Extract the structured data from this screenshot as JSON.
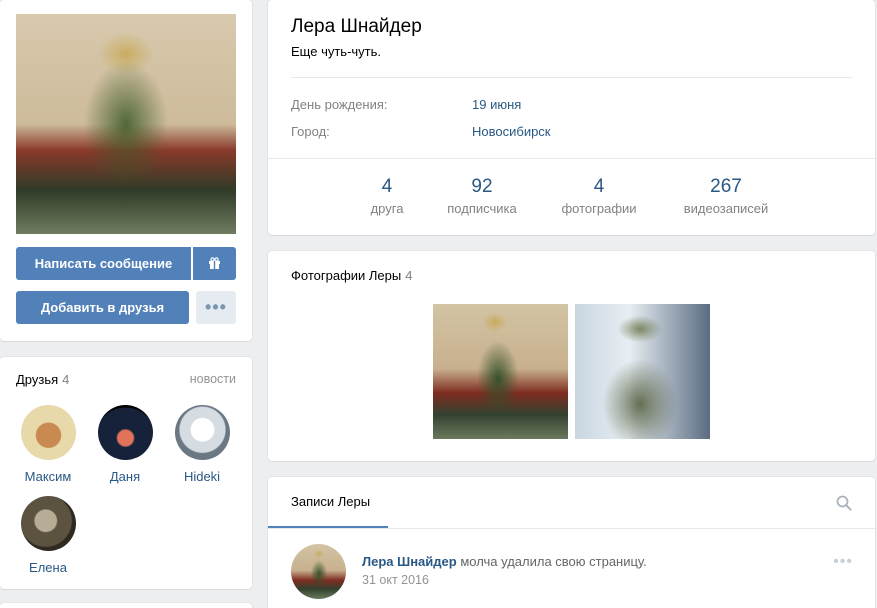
{
  "profile": {
    "name": "Лера Шнайдер",
    "status": "Еще чуть-чуть.",
    "info": [
      {
        "label": "День рождения:",
        "value": "19 июня"
      },
      {
        "label": "Город:",
        "value": "Новосибирск"
      }
    ],
    "stats": [
      {
        "num": "4",
        "label": "друга"
      },
      {
        "num": "92",
        "label": "подписчика"
      },
      {
        "num": "4",
        "label": "фотографии"
      },
      {
        "num": "267",
        "label": "видеозаписей"
      }
    ]
  },
  "actions": {
    "message_label": "Написать сообщение",
    "gift_icon": "gift-icon",
    "add_friend_label": "Добавить в друзья",
    "more_label": "•••"
  },
  "friends": {
    "title": "Друзья",
    "count": "4",
    "news_link": "новости",
    "items": [
      {
        "name": "Максим"
      },
      {
        "name": "Даня"
      },
      {
        "name": "Hideki"
      },
      {
        "name": "Елена"
      }
    ]
  },
  "photos": {
    "title": "Фотографии Леры",
    "count": "4"
  },
  "posts": {
    "tab_label": "Записи Леры",
    "search_icon": "search-icon",
    "items": [
      {
        "author": "Лера Шнайдер",
        "action": "молча удалила свою страницу.",
        "date": "31 окт 2016",
        "more": "•••"
      }
    ]
  },
  "colors": {
    "accent": "#5181b8",
    "link": "#2a5885",
    "muted": "#828282",
    "background": "#edeef0"
  }
}
